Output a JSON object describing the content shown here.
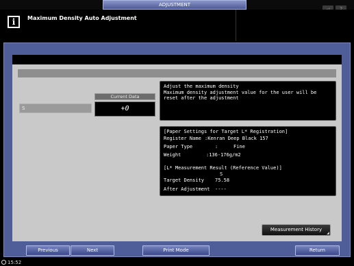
{
  "topbar": {
    "tab_label": "ADJUSTMENT",
    "icon1": "speaker-icon",
    "icon2": "help-icon",
    "icon2_glyph": "?"
  },
  "header": {
    "title": "Maximum Density Auto Adjustment",
    "info_glyph": "i"
  },
  "current_data": {
    "label": "Current Data",
    "value": "+0"
  },
  "setting_row": {
    "label": "S"
  },
  "message": {
    "lines": [
      "Adjust the maximum density",
      "Maximum density adjustment value for the user will be",
      "reset after the adjustment"
    ]
  },
  "paper": {
    "heading": "[Paper Settings for Target L* Registration]",
    "register_name_label": "Register Name",
    "register_name_value": ":Kenran Deep Black 157",
    "paper_type_label": "Paper Type",
    "paper_type_colon": ":",
    "paper_type_value": "Fine",
    "weight_label": "Weight",
    "weight_value": ":136-176g/m2",
    "result_heading": "[L* Measurement Result (Reference Value)]",
    "result_column": "S",
    "target_label": "Target Density",
    "target_value": "75.58",
    "after_label": "After Adjustment",
    "after_value": "----"
  },
  "measurement_history_label": "Measurement History",
  "buttons": {
    "previous": "Previous",
    "next": "Next",
    "print_mode": "Print Mode",
    "return": "Return"
  },
  "status": {
    "time": "15:52"
  }
}
